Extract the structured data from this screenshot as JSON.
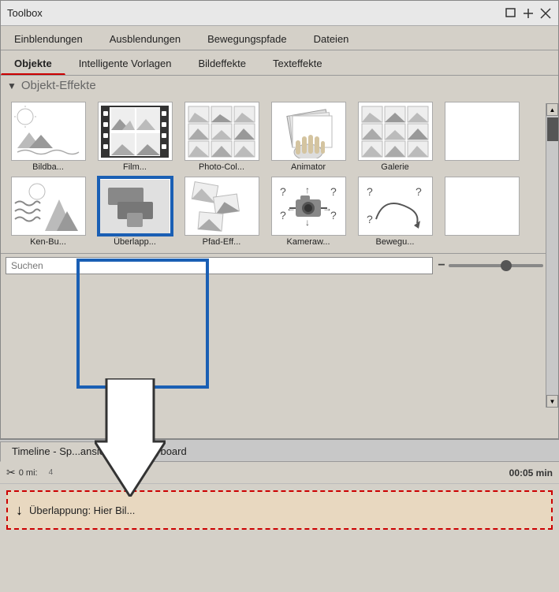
{
  "window": {
    "title": "Toolbox",
    "controls": {
      "minimize": "🗖",
      "pin": "📌",
      "close": "✕"
    }
  },
  "tabs_row1": {
    "items": [
      {
        "label": "Einblendungen",
        "active": false
      },
      {
        "label": "Ausblendungen",
        "active": false
      },
      {
        "label": "Bewegungspfade",
        "active": false
      },
      {
        "label": "Dateien",
        "active": false
      }
    ]
  },
  "tabs_row2": {
    "items": [
      {
        "label": "Objekte",
        "active": true
      },
      {
        "label": "Intelligente Vorlagen",
        "active": false
      },
      {
        "label": "Bildeffekte",
        "active": false
      },
      {
        "label": "Texteffekte",
        "active": false
      }
    ]
  },
  "section": {
    "title": "Objekt-Effekte"
  },
  "effects": [
    {
      "label": "Bildba...",
      "type": "bildbahn"
    },
    {
      "label": "Film...",
      "type": "film"
    },
    {
      "label": "Photo-Col...",
      "type": "photo-col"
    },
    {
      "label": "Animator",
      "type": "animator"
    },
    {
      "label": "Galerie",
      "type": "galerie"
    },
    {
      "label": "",
      "type": "extra1"
    },
    {
      "label": "Ken-Bu...",
      "type": "kenbu"
    },
    {
      "label": "Überlapp...",
      "type": "ueberlapp",
      "selected": true
    },
    {
      "label": "Pfad-Eff...",
      "type": "pfad"
    },
    {
      "label": "Kameraw...",
      "type": "kamera"
    },
    {
      "label": "Bewegu...",
      "type": "bewegung"
    },
    {
      "label": "",
      "type": "extra2"
    }
  ],
  "search": {
    "placeholder": "Suchen",
    "value": ""
  },
  "slider": {
    "min_label": "−",
    "max_label": "+"
  },
  "timeline": {
    "tabs": [
      {
        "label": "Timeline - Sp...ansicht",
        "active": true
      },
      {
        "label": "Storyboard",
        "active": false
      }
    ],
    "ruler": {
      "start": "0 mi:",
      "marker": "00:05 min"
    },
    "drop_zone_text": "↓ Überlappung: Hier Bil...",
    "drop_zone_icon": "↓"
  }
}
